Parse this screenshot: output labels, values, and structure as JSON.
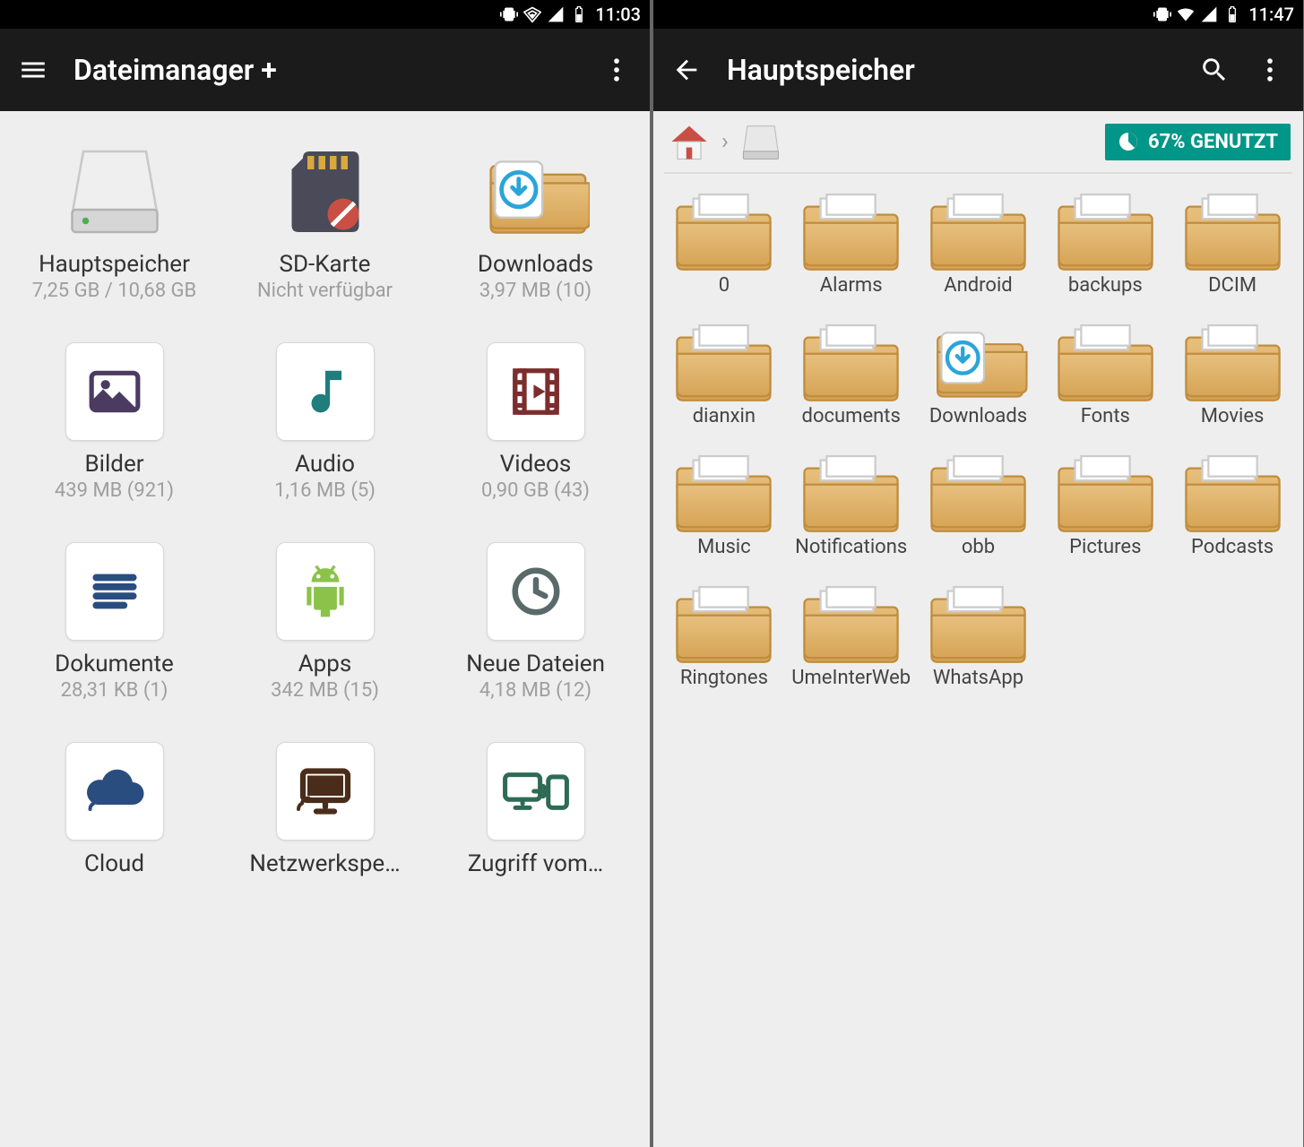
{
  "left": {
    "status": {
      "time": "11:03"
    },
    "appbar": {
      "title": "Dateimanager +"
    },
    "categories": [
      {
        "name": "Hauptspeicher",
        "sub": "7,25 GB / 10,68 GB",
        "icon": "drive"
      },
      {
        "name": "SD-Karte",
        "sub": "Nicht verfügbar",
        "icon": "sdcard"
      },
      {
        "name": "Downloads",
        "sub": "3,97 MB (10)",
        "icon": "downloads-folder"
      },
      {
        "name": "Bilder",
        "sub": "439 MB (921)",
        "icon": "image"
      },
      {
        "name": "Audio",
        "sub": "1,16 MB (5)",
        "icon": "music"
      },
      {
        "name": "Videos",
        "sub": "0,90 GB (43)",
        "icon": "video"
      },
      {
        "name": "Dokumente",
        "sub": "28,31 KB (1)",
        "icon": "document"
      },
      {
        "name": "Apps",
        "sub": "342 MB (15)",
        "icon": "android"
      },
      {
        "name": "Neue Dateien",
        "sub": "4,18 MB (12)",
        "icon": "clock"
      },
      {
        "name": "Cloud",
        "sub": "",
        "icon": "cloud"
      },
      {
        "name": "Netzwerkspe…",
        "sub": "",
        "icon": "monitor"
      },
      {
        "name": "Zugriff vom…",
        "sub": "",
        "icon": "transfer"
      }
    ]
  },
  "right": {
    "status": {
      "time": "11:47"
    },
    "appbar": {
      "title": "Hauptspeicher"
    },
    "usage": {
      "text": "67% GENUTZT",
      "percent": 67
    },
    "folders": [
      {
        "name": "0",
        "type": "folder"
      },
      {
        "name": "Alarms",
        "type": "folder"
      },
      {
        "name": "Android",
        "type": "folder"
      },
      {
        "name": "backups",
        "type": "folder"
      },
      {
        "name": "DCIM",
        "type": "folder"
      },
      {
        "name": "dianxin",
        "type": "folder"
      },
      {
        "name": "documents",
        "type": "folder"
      },
      {
        "name": "Downloads",
        "type": "downloads-folder"
      },
      {
        "name": "Fonts",
        "type": "folder"
      },
      {
        "name": "Movies",
        "type": "folder"
      },
      {
        "name": "Music",
        "type": "folder"
      },
      {
        "name": "Notifications",
        "type": "folder"
      },
      {
        "name": "obb",
        "type": "folder"
      },
      {
        "name": "Pictures",
        "type": "folder"
      },
      {
        "name": "Podcasts",
        "type": "folder"
      },
      {
        "name": "Ringtones",
        "type": "folder"
      },
      {
        "name": "UmeInterWeb",
        "type": "folder"
      },
      {
        "name": "WhatsApp",
        "type": "folder"
      }
    ]
  }
}
